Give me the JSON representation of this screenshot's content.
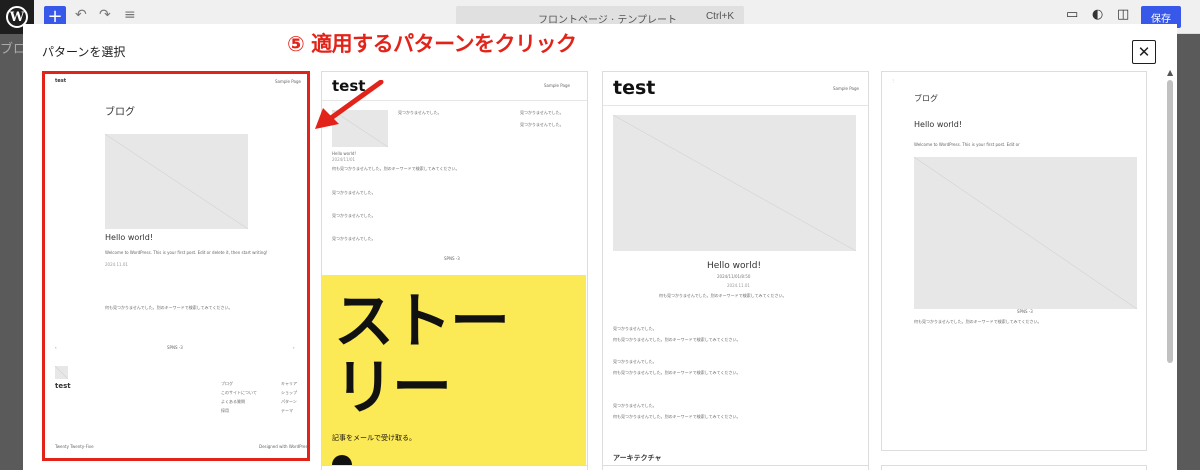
{
  "toolbar": {
    "logo": "W",
    "add_label": "+",
    "undo_icon": "↶",
    "redo_icon": "↷",
    "list_icon": "≡",
    "command_title": "フロントページ · テンプレート",
    "command_shortcut": "Ctrl+K",
    "device_icon": "▭",
    "styles_icon": "◐",
    "sidebar_icon": "◫",
    "save_label": "保存"
  },
  "background_text": "ブログ",
  "modal": {
    "title": "パターンを選択",
    "close_icon": "✕"
  },
  "annotation": "⑤ 適用するパターンをクリック",
  "patterns": {
    "p1": {
      "site_title": "test",
      "nav_link": "Sample Page",
      "heading": "ブログ",
      "post_title": "Hello world!",
      "excerpt": "Welcome to WordPress. This is your first post. Edit or delete it, then start writing!",
      "date": "2024.11.01",
      "no_results": "何も見つかりませんでした。別のキーワードで検索してみてください。",
      "pagination": "SPNS -3",
      "prev": "‹",
      "next": "›",
      "footer_title": "test",
      "footer_links": [
        "ブログ",
        "このサイトについて",
        "よくある質問",
        "採用",
        "キャリア",
        "ショップ",
        "パターン",
        "テーマ"
      ],
      "credit_left": "Twenty Twenty-Five",
      "credit_right": "Designed with WordPress"
    },
    "p2": {
      "site_title": "test",
      "nav_link": "Sample Page",
      "post_title": "Hello world!",
      "meta": "2024/11/01",
      "col_text": "見つかりませんでした。",
      "no_results": "何も見つかりませんでした。別のキーワードで検索してみてください。",
      "pagination": "SPNS -3",
      "story": "ストーリー",
      "subscribe": "記事をメールで受け取る。"
    },
    "p3": {
      "site_title": "test",
      "nav_link": "Sample Page",
      "post_title": "Hello world!",
      "meta": "2024/11/01/8:50",
      "date": "2024.11.01",
      "no_results": "何も見つかりませんでした。別のキーワードで検索してみてください。",
      "line1": "見つかりませんでした。",
      "line2": "何も見つかりませんでした。別のキーワードで検索してみてください。",
      "section": "アーキテクチャ"
    },
    "p4": {
      "heading": "ブログ",
      "post_title": "Hello world!",
      "excerpt": "Welcome to WordPress. This is your first post. Edit or",
      "pagination": "SPNS -3",
      "no_results": "何も見つかりませんでした。別のキーワードで検索してみてください。"
    }
  },
  "colors": {
    "accent": "#3858e9",
    "annotation_red": "#e2231a",
    "story_yellow": "#fbe955"
  }
}
